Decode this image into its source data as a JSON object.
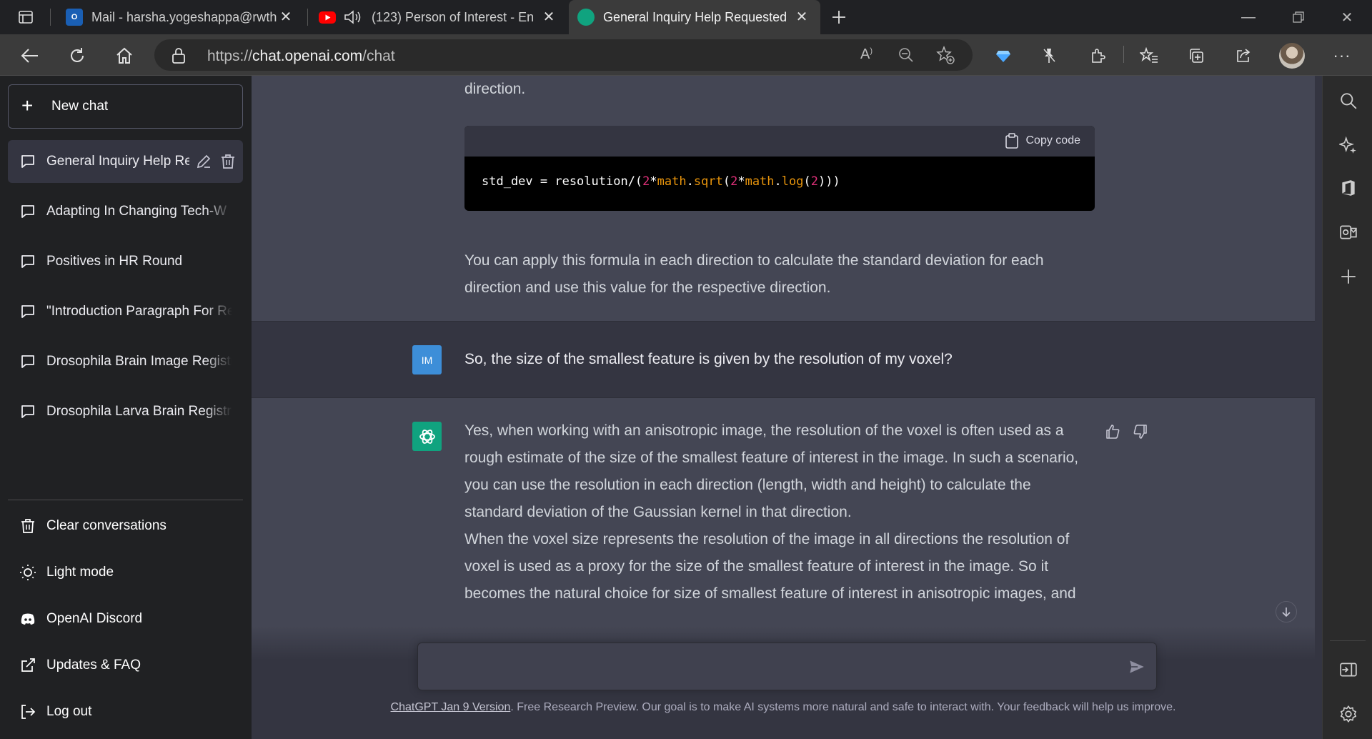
{
  "browser": {
    "tabs": [
      {
        "title": "Mail - harsha.yogeshappa@rwth",
        "active": false
      },
      {
        "title": "(123) Person of Interest - En",
        "active": false
      },
      {
        "title": "General Inquiry Help Requested",
        "active": true
      }
    ],
    "url_prefix": "https://",
    "url_host": "chat.openai.com",
    "url_path": "/chat"
  },
  "sidebar": {
    "new_chat_label": "New chat",
    "conversations": [
      {
        "label": "General Inquiry Help Re",
        "active": true
      },
      {
        "label": "Adapting In Changing Tech-W",
        "active": false
      },
      {
        "label": "Positives in HR Round",
        "active": false
      },
      {
        "label": "\"Introduction Paragraph For Re",
        "active": false
      },
      {
        "label": "Drosophila Brain Image Registr",
        "active": false
      },
      {
        "label": "Drosophila Larva Brain Registra",
        "active": false
      }
    ],
    "menu": [
      {
        "label": "Clear conversations",
        "icon": "trash-icon"
      },
      {
        "label": "Light mode",
        "icon": "sun-icon"
      },
      {
        "label": "OpenAI Discord",
        "icon": "discord-icon"
      },
      {
        "label": "Updates & FAQ",
        "icon": "external-link-icon"
      },
      {
        "label": "Log out",
        "icon": "logout-icon"
      }
    ]
  },
  "chat": {
    "prev_tail": "direction.",
    "code_copy_label": "Copy code",
    "code_line": {
      "p1": "std_dev = resolution/(",
      "n1": "2",
      "p2": "*",
      "f1": "math",
      "p3": ".",
      "f2": "sqrt",
      "p4": "(",
      "n2": "2",
      "p5": "*",
      "f3": "math",
      "p6": ".",
      "f4": "log",
      "p7": "(",
      "n3": "2",
      "p8": ")))"
    },
    "after_code_text": "You can apply this formula in each direction to calculate the standard deviation for each direction and use this value for the respective direction.",
    "user_initials": "IM",
    "user_message": "So, the size of the smallest feature is given by the resolution of my voxel?",
    "assistant_p1": "Yes, when working with an anisotropic image, the resolution of the voxel is often used as a rough estimate of the size of the smallest feature of interest in the image. In such a scenario, you can use the resolution in each direction (length, width and height) to calculate the standard deviation of the Gaussian kernel in that direction.",
    "assistant_p2": "When the voxel size represents the resolution of the image in all directions the resolution of voxel is used as a proxy for the size of the smallest feature of interest in the image. So it becomes the natural choice for size of smallest feature of interest in anisotropic images, and"
  },
  "composer": {
    "placeholder": ""
  },
  "footer": {
    "link_text": "ChatGPT Jan 9 Version",
    "text": ". Free Research Preview. Our goal is to make AI systems more natural and safe to interact with. Your feedback will help us improve."
  },
  "colors": {
    "sidebar_bg": "#202123",
    "main_bg": "#343541",
    "assistant_bg": "#444654",
    "gpt_green": "#10a37f",
    "user_avatar": "#3d8ed8"
  }
}
